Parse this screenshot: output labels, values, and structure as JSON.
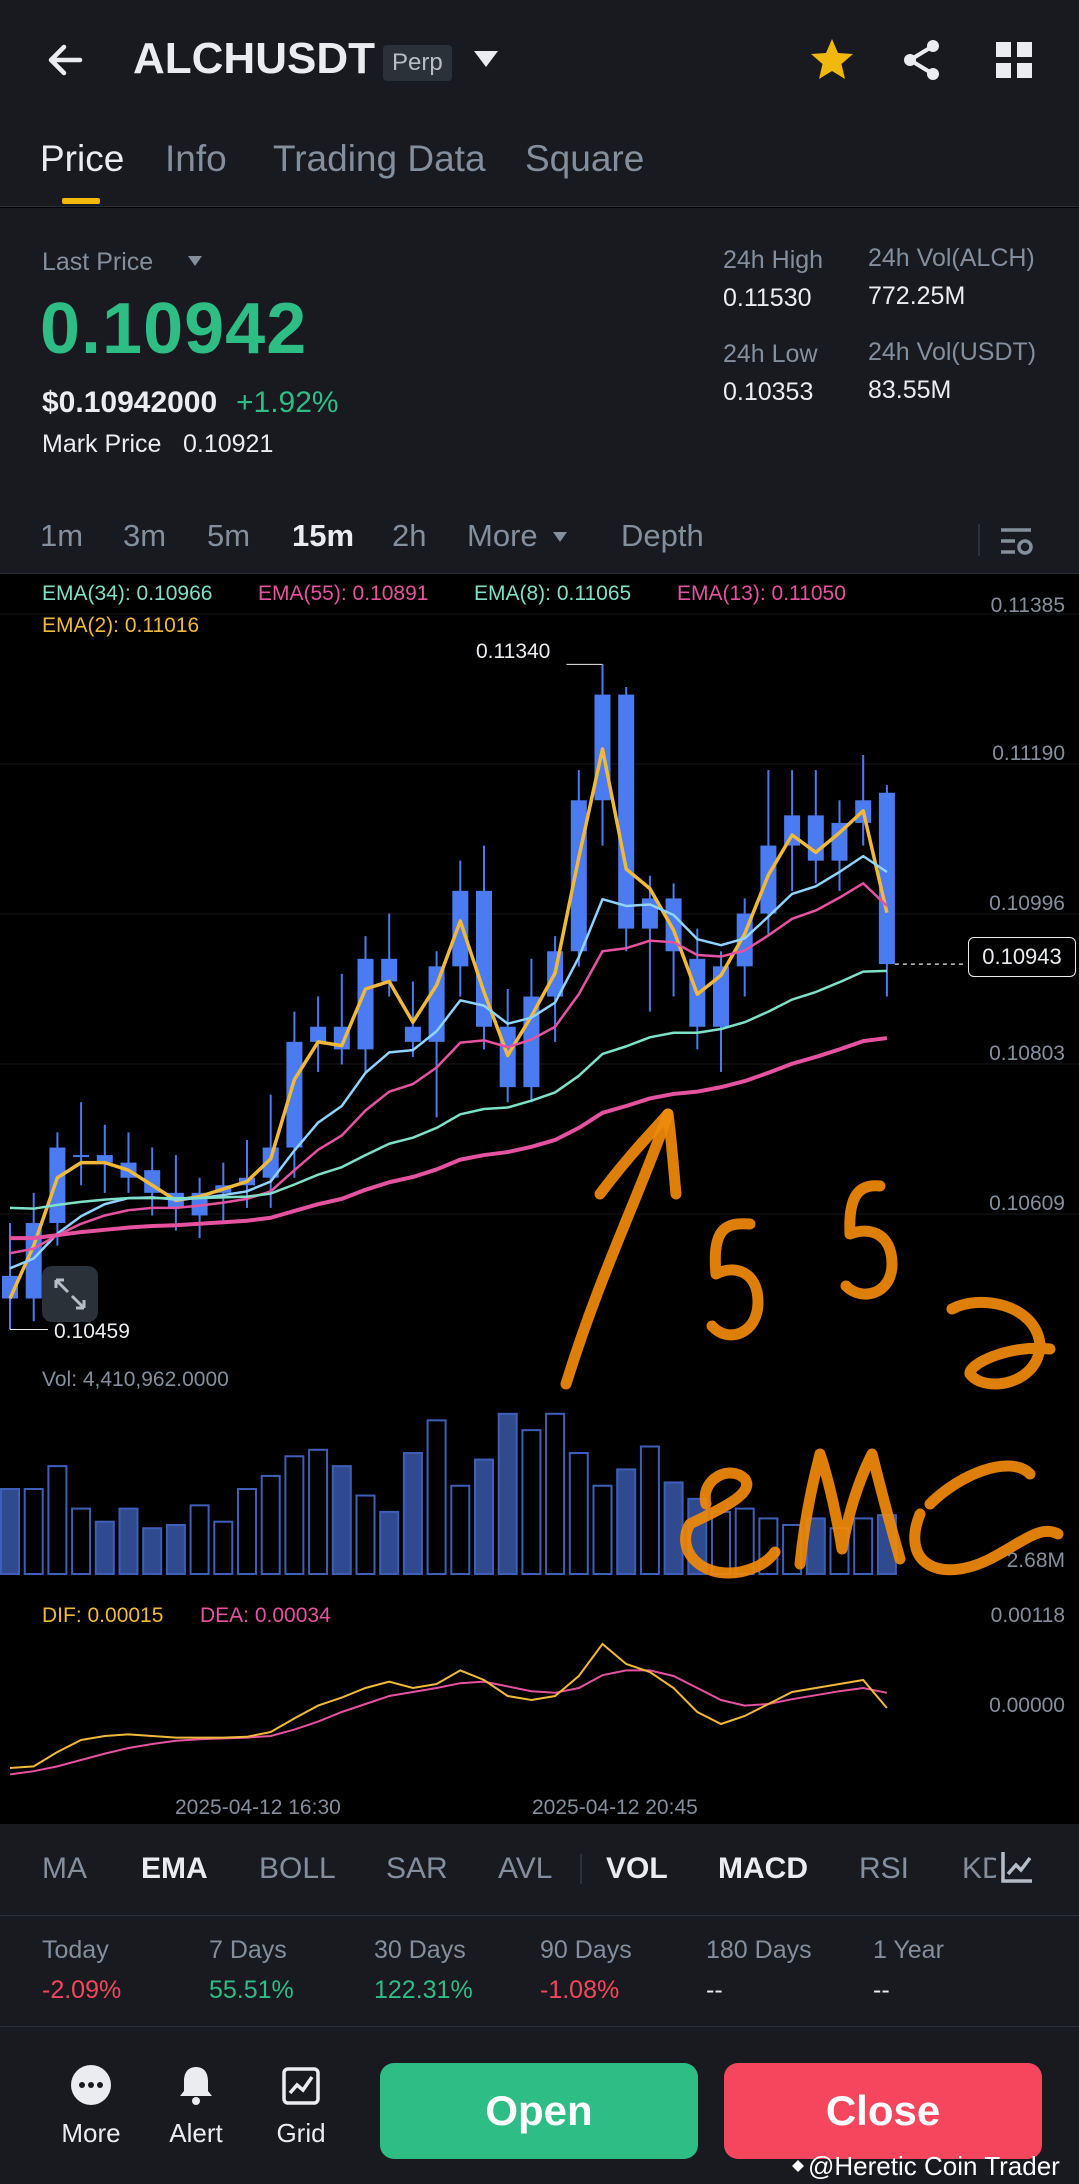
{
  "header": {
    "symbol": "ALCHUSDT",
    "badge": "Perp",
    "tabs": [
      "Price",
      "Info",
      "Trading Data",
      "Square"
    ],
    "active_tab": "Price",
    "icons": [
      "back-arrow-icon",
      "chevron-down-icon",
      "star-icon",
      "share-icon",
      "grid-icon"
    ],
    "star_color": "#f0b90b"
  },
  "ticker": {
    "last_price_label": "Last Price",
    "last_price": "0.10942",
    "usd_price": "$0.10942000",
    "change": "+1.92%",
    "mark_price_label": "Mark Price",
    "mark_price": "0.10921",
    "high_label": "24h High",
    "high": "0.11530",
    "low_label": "24h Low",
    "low": "0.10353",
    "vol_base_label": "24h Vol(ALCH)",
    "vol_base": "772.25M",
    "vol_quote_label": "24h Vol(USDT)",
    "vol_quote": "83.55M",
    "up_color": "#2ebd85",
    "down_color": "#f6465d"
  },
  "intervals": {
    "items": [
      "1m",
      "3m",
      "5m",
      "15m",
      "2h"
    ],
    "more": "More",
    "depth": "Depth",
    "active": "15m"
  },
  "chart": {
    "ema_labels": {
      "ema34": "EMA(34): 0.10966",
      "ema55": "EMA(55): 0.10891",
      "ema8": "EMA(8): 0.11065",
      "ema13": "EMA(13): 0.11050",
      "ema2": "EMA(2): 0.11016"
    },
    "price_axis": [
      "0.11385",
      "0.11190",
      "0.10996",
      "0.10803",
      "0.10609"
    ],
    "last_price_tag": "0.10943",
    "max_label": "0.11340",
    "min_label": "0.10459",
    "vol_label": "Vol: 4,410,962.0000",
    "vol_axis": [
      "2.68M"
    ],
    "dif_label": "DIF: 0.00015",
    "dea_label": "DEA: 0.00034",
    "macd_axis": [
      "0.00118",
      "0.00000"
    ],
    "dates": [
      "2025-04-12 16:30",
      "2025-04-12 20:45"
    ],
    "annotation": "55 ema",
    "annotation_color": "#f08a0a",
    "candle_color": "#4a7bf0",
    "colors": {
      "ema34": "#7fe0c8",
      "ema55": "#e552a0",
      "ema8": "#8fd3ff",
      "ema13": "#e552a0",
      "ema2": "#f0b93a"
    }
  },
  "indicators": {
    "items": [
      "MA",
      "EMA",
      "BOLL",
      "SAR",
      "AVL",
      "VOL",
      "MACD",
      "RSI",
      "KDJ"
    ],
    "active": [
      "EMA",
      "VOL",
      "MACD"
    ]
  },
  "performance": [
    {
      "label": "Today",
      "value": "-2.09%",
      "dir": "down"
    },
    {
      "label": "7 Days",
      "value": "55.51%",
      "dir": "up"
    },
    {
      "label": "30 Days",
      "value": "122.31%",
      "dir": "up"
    },
    {
      "label": "90 Days",
      "value": "-1.08%",
      "dir": "down"
    },
    {
      "label": "180 Days",
      "value": "--",
      "dir": "flat"
    },
    {
      "label": "1 Year",
      "value": "--",
      "dir": "flat"
    }
  ],
  "bottom": {
    "more": "More",
    "alert": "Alert",
    "grid": "Grid",
    "open": "Open",
    "close": "Close",
    "watermark": "@Heretic Coin Trader"
  },
  "chart_data": {
    "type": "candlestick",
    "title": "",
    "interval": "15m",
    "ylim": [
      0.104,
      0.1142
    ],
    "candles": [
      {
        "o": 0.1053,
        "h": 0.106,
        "l": 0.10459,
        "c": 0.105
      },
      {
        "o": 0.105,
        "h": 0.1064,
        "l": 0.1047,
        "c": 0.106
      },
      {
        "o": 0.106,
        "h": 0.1072,
        "l": 0.1057,
        "c": 0.107
      },
      {
        "o": 0.1069,
        "h": 0.1076,
        "l": 0.1065,
        "c": 0.1069
      },
      {
        "o": 0.1069,
        "h": 0.1073,
        "l": 0.1064,
        "c": 0.1068
      },
      {
        "o": 0.1068,
        "h": 0.1072,
        "l": 0.1064,
        "c": 0.1066
      },
      {
        "o": 0.1067,
        "h": 0.107,
        "l": 0.1061,
        "c": 0.1064
      },
      {
        "o": 0.1064,
        "h": 0.1069,
        "l": 0.1059,
        "c": 0.1062
      },
      {
        "o": 0.1061,
        "h": 0.1066,
        "l": 0.1058,
        "c": 0.1064
      },
      {
        "o": 0.1064,
        "h": 0.1068,
        "l": 0.106,
        "c": 0.1065
      },
      {
        "o": 0.1065,
        "h": 0.1071,
        "l": 0.1062,
        "c": 0.1066
      },
      {
        "o": 0.1066,
        "h": 0.1077,
        "l": 0.1062,
        "c": 0.107
      },
      {
        "o": 0.107,
        "h": 0.1088,
        "l": 0.1066,
        "c": 0.1084
      },
      {
        "o": 0.1084,
        "h": 0.109,
        "l": 0.108,
        "c": 0.1086
      },
      {
        "o": 0.1086,
        "h": 0.1093,
        "l": 0.1081,
        "c": 0.1083
      },
      {
        "o": 0.1083,
        "h": 0.1098,
        "l": 0.108,
        "c": 0.1095
      },
      {
        "o": 0.1095,
        "h": 0.1101,
        "l": 0.109,
        "c": 0.1092
      },
      {
        "o": 0.1086,
        "h": 0.1092,
        "l": 0.1082,
        "c": 0.1084
      },
      {
        "o": 0.1084,
        "h": 0.1096,
        "l": 0.1074,
        "c": 0.1094
      },
      {
        "o": 0.1094,
        "h": 0.1108,
        "l": 0.109,
        "c": 0.1104
      },
      {
        "o": 0.1104,
        "h": 0.111,
        "l": 0.1083,
        "c": 0.1086
      },
      {
        "o": 0.1086,
        "h": 0.1091,
        "l": 0.1076,
        "c": 0.1078
      },
      {
        "o": 0.1078,
        "h": 0.1095,
        "l": 0.1076,
        "c": 0.109
      },
      {
        "o": 0.109,
        "h": 0.1098,
        "l": 0.1084,
        "c": 0.1096
      },
      {
        "o": 0.1096,
        "h": 0.112,
        "l": 0.1094,
        "c": 0.1116
      },
      {
        "o": 0.1116,
        "h": 0.1134,
        "l": 0.111,
        "c": 0.113
      },
      {
        "o": 0.113,
        "h": 0.1131,
        "l": 0.1096,
        "c": 0.1099
      },
      {
        "o": 0.1099,
        "h": 0.1106,
        "l": 0.1088,
        "c": 0.1103
      },
      {
        "o": 0.1103,
        "h": 0.1105,
        "l": 0.109,
        "c": 0.1096
      },
      {
        "o": 0.1095,
        "h": 0.1099,
        "l": 0.1083,
        "c": 0.1086
      },
      {
        "o": 0.1086,
        "h": 0.1096,
        "l": 0.108,
        "c": 0.1094
      },
      {
        "o": 0.1094,
        "h": 0.1103,
        "l": 0.109,
        "c": 0.1101
      },
      {
        "o": 0.1101,
        "h": 0.112,
        "l": 0.1098,
        "c": 0.111
      },
      {
        "o": 0.111,
        "h": 0.112,
        "l": 0.1104,
        "c": 0.1114
      },
      {
        "o": 0.1114,
        "h": 0.112,
        "l": 0.1105,
        "c": 0.1108
      },
      {
        "o": 0.1108,
        "h": 0.1116,
        "l": 0.1104,
        "c": 0.1113
      },
      {
        "o": 0.1113,
        "h": 0.1122,
        "l": 0.111,
        "c": 0.1116
      },
      {
        "o": 0.1117,
        "h": 0.1118,
        "l": 0.109,
        "c": 0.10943
      }
    ],
    "volume": [
      2.6,
      2.6,
      3.3,
      2.0,
      1.6,
      2.0,
      1.4,
      1.5,
      2.1,
      1.6,
      2.6,
      3.0,
      3.6,
      3.8,
      3.3,
      2.4,
      1.9,
      3.7,
      4.7,
      2.7,
      3.5,
      4.9,
      4.4,
      4.9,
      3.7,
      2.7,
      3.2,
      3.9,
      2.8,
      2.3,
      1.9,
      2.0,
      1.7,
      1.5,
      1.7,
      1.4,
      1.7,
      1.8
    ],
    "series": [
      {
        "name": "EMA(2)",
        "values": [
          0.105,
          0.1057,
          0.1066,
          0.1068,
          0.1068,
          0.1067,
          0.1065,
          0.1063,
          0.10635,
          0.10645,
          0.10655,
          0.10685,
          0.1079,
          0.1084,
          0.10835,
          0.1091,
          0.1092,
          0.10866,
          0.10915,
          0.11,
          0.10906,
          0.10822,
          0.10874,
          0.10931,
          0.11084,
          0.11228,
          0.11069,
          0.11043,
          0.10988,
          0.10903,
          0.10928,
          0.10983,
          0.11061,
          0.11114,
          0.11091,
          0.11117,
          0.11146,
          0.11011
        ]
      },
      {
        "name": "EMA(8)",
        "values": [
          0.1054,
          0.10553,
          0.10586,
          0.10609,
          0.10625,
          0.10633,
          0.10634,
          0.10631,
          0.10633,
          0.10637,
          0.10642,
          0.10655,
          0.10696,
          0.10733,
          0.10755,
          0.10799,
          0.10826,
          0.10829,
          0.10854,
          0.10895,
          0.10888,
          0.10864,
          0.10872,
          0.10892,
          0.10952,
          0.11029,
          0.1102,
          0.11022,
          0.11008,
          0.10976,
          0.10968,
          0.10977,
          0.11006,
          0.11036,
          0.11046,
          0.11065,
          0.11086,
          0.11065
        ]
      },
      {
        "name": "EMA(13)",
        "values": [
          0.1056,
          0.10566,
          0.10584,
          0.10599,
          0.1061,
          0.10617,
          0.1062,
          0.1062,
          0.10623,
          0.10627,
          0.10632,
          0.10642,
          0.1067,
          0.10697,
          0.10716,
          0.10749,
          0.10774,
          0.10784,
          0.10806,
          0.10839,
          0.10842,
          0.10833,
          0.10843,
          0.1086,
          0.10903,
          0.1096,
          0.10964,
          0.10974,
          0.10972,
          0.10955,
          0.10953,
          0.10961,
          0.10981,
          0.11003,
          0.11014,
          0.11031,
          0.1105,
          0.1102
        ]
      },
      {
        "name": "EMA(34)",
        "values": [
          0.1062,
          0.10619,
          0.10624,
          0.10628,
          0.10631,
          0.10633,
          0.10633,
          0.10633,
          0.10633,
          0.10634,
          0.10635,
          0.10639,
          0.10651,
          0.10664,
          0.10674,
          0.1069,
          0.10705,
          0.10713,
          0.10726,
          0.10744,
          0.10751,
          0.10753,
          0.10762,
          0.10773,
          0.10795,
          0.10824,
          0.10834,
          0.10846,
          0.10852,
          0.10852,
          0.10857,
          0.10866,
          0.1088,
          0.10896,
          0.10906,
          0.10919,
          0.10933,
          0.10934
        ]
      },
      {
        "name": "EMA(55)",
        "values": [
          0.1058,
          0.1058,
          0.10584,
          0.10588,
          0.10591,
          0.10594,
          0.10596,
          0.10597,
          0.10599,
          0.10601,
          0.10603,
          0.10607,
          0.10616,
          0.10625,
          0.10632,
          0.10644,
          0.10654,
          0.10661,
          0.10671,
          0.10684,
          0.1069,
          0.10694,
          0.10701,
          0.1071,
          0.10726,
          0.10746,
          0.10755,
          0.10765,
          0.10771,
          0.10774,
          0.1078,
          0.10788,
          0.10799,
          0.10811,
          0.1082,
          0.1083,
          0.10841,
          0.10845
        ]
      }
    ],
    "macd": {
      "dif": [
        -0.0006,
        -0.00058,
        -0.0004,
        -0.00025,
        -0.0002,
        -0.00018,
        -0.0002,
        -0.00022,
        -0.00022,
        -0.00022,
        -0.00021,
        -0.00015,
        2e-05,
        0.00018,
        0.00028,
        0.0004,
        0.00048,
        0.0004,
        0.00045,
        0.00062,
        0.0005,
        0.0003,
        0.00025,
        0.0003,
        0.00055,
        0.00095,
        0.0007,
        0.0006,
        0.0004,
        0.0001,
        -5e-05,
        5e-05,
        0.0002,
        0.00035,
        0.0004,
        0.00045,
        0.0005,
        0.00015
      ],
      "dea": [
        -0.00068,
        -0.00064,
        -0.00058,
        -0.0005,
        -0.00042,
        -0.00035,
        -0.0003,
        -0.00026,
        -0.00024,
        -0.00023,
        -0.00022,
        -0.0002,
        -0.00012,
        -2e-05,
        0.0001,
        0.0002,
        0.0003,
        0.00035,
        0.0004,
        0.00046,
        0.00048,
        0.00042,
        0.00036,
        0.00034,
        0.0004,
        0.00056,
        0.00062,
        0.00062,
        0.00055,
        0.0004,
        0.00025,
        0.00018,
        0.0002,
        0.00026,
        0.00031,
        0.00036,
        0.0004,
        0.00034
      ]
    }
  }
}
